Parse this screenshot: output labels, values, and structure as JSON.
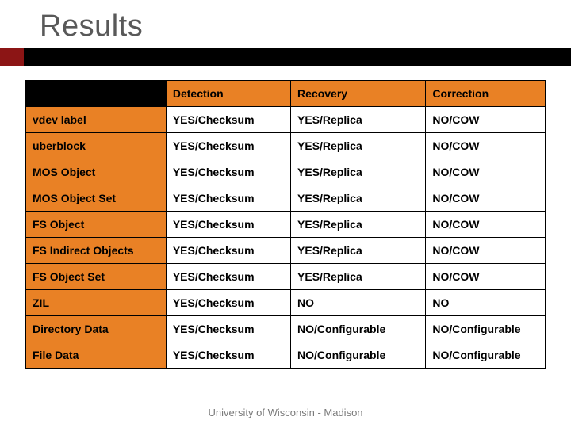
{
  "title": "Results",
  "columns": [
    "Detection",
    "Recovery",
    "Correction"
  ],
  "rows": [
    {
      "label": "vdev label",
      "values": [
        "YES/Checksum",
        "YES/Replica",
        "NO/COW"
      ]
    },
    {
      "label": "uberblock",
      "values": [
        "YES/Checksum",
        "YES/Replica",
        "NO/COW"
      ]
    },
    {
      "label": "MOS Object",
      "values": [
        "YES/Checksum",
        "YES/Replica",
        "NO/COW"
      ]
    },
    {
      "label": "MOS Object Set",
      "values": [
        "YES/Checksum",
        "YES/Replica",
        "NO/COW"
      ]
    },
    {
      "label": "FS Object",
      "values": [
        "YES/Checksum",
        "YES/Replica",
        "NO/COW"
      ]
    },
    {
      "label": "FS Indirect Objects",
      "values": [
        "YES/Checksum",
        "YES/Replica",
        "NO/COW"
      ]
    },
    {
      "label": "FS Object Set",
      "values": [
        "YES/Checksum",
        "YES/Replica",
        "NO/COW"
      ]
    },
    {
      "label": "ZIL",
      "values": [
        "YES/Checksum",
        "NO",
        "NO"
      ]
    },
    {
      "label": "Directory Data",
      "values": [
        "YES/Checksum",
        "NO/Configurable",
        "NO/Configurable"
      ]
    },
    {
      "label": "File Data",
      "values": [
        "YES/Checksum",
        "NO/Configurable",
        "NO/Configurable"
      ]
    }
  ],
  "footer": "University of Wisconsin - Madison",
  "chart_data": {
    "type": "table",
    "title": "Results",
    "columns": [
      "",
      "Detection",
      "Recovery",
      "Correction"
    ],
    "rows": [
      [
        "vdev label",
        "YES/Checksum",
        "YES/Replica",
        "NO/COW"
      ],
      [
        "uberblock",
        "YES/Checksum",
        "YES/Replica",
        "NO/COW"
      ],
      [
        "MOS Object",
        "YES/Checksum",
        "YES/Replica",
        "NO/COW"
      ],
      [
        "MOS Object Set",
        "YES/Checksum",
        "YES/Replica",
        "NO/COW"
      ],
      [
        "FS Object",
        "YES/Checksum",
        "YES/Replica",
        "NO/COW"
      ],
      [
        "FS Indirect Objects",
        "YES/Checksum",
        "YES/Replica",
        "NO/COW"
      ],
      [
        "FS Object Set",
        "YES/Checksum",
        "YES/Replica",
        "NO/COW"
      ],
      [
        "ZIL",
        "YES/Checksum",
        "NO",
        "NO"
      ],
      [
        "Directory Data",
        "YES/Checksum",
        "NO/Configurable",
        "NO/Configurable"
      ],
      [
        "File Data",
        "YES/Checksum",
        "NO/Configurable",
        "NO/Configurable"
      ]
    ]
  }
}
